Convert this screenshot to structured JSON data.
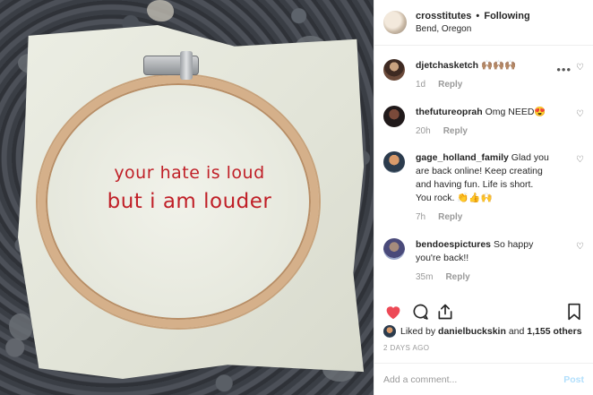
{
  "photo": {
    "alt_line1": "your hate is loud",
    "alt_line2": "but i am louder"
  },
  "header": {
    "username": "crosstitutes",
    "separator": "•",
    "follow_status": "Following",
    "location": "Bend, Oregon"
  },
  "comments": [
    {
      "username": "djetchasketch",
      "text": "🙌🏽🙌🏽🙌🏽",
      "age": "1d",
      "reply_label": "Reply"
    },
    {
      "username": "thefutureoprah",
      "text": "Omg NEED😍",
      "age": "20h",
      "reply_label": "Reply"
    },
    {
      "username": "gage_holland_family",
      "text": "Glad you are back online! Keep creating and having fun. Life is short. You rock. 👏👍🙌",
      "age": "7h",
      "reply_label": "Reply"
    },
    {
      "username": "bendoespictures",
      "text": "So happy you're back!!",
      "age": "35m",
      "reply_label": "Reply"
    }
  ],
  "likes": {
    "prefix": "Liked by",
    "user": "danielbuckskin",
    "connector": "and",
    "count_text": "1,155 others"
  },
  "time_ago": "2 DAYS AGO",
  "add_comment": {
    "placeholder": "Add a comment...",
    "post_label": "Post"
  },
  "colors": {
    "like_active": "#ed4956",
    "post_disabled": "#b2dffc",
    "stitch_red": "#c01f27"
  },
  "icons": [
    "heart-icon",
    "comment-icon",
    "share-icon",
    "bookmark-icon",
    "more-icon",
    "comment-heart-icon"
  ]
}
